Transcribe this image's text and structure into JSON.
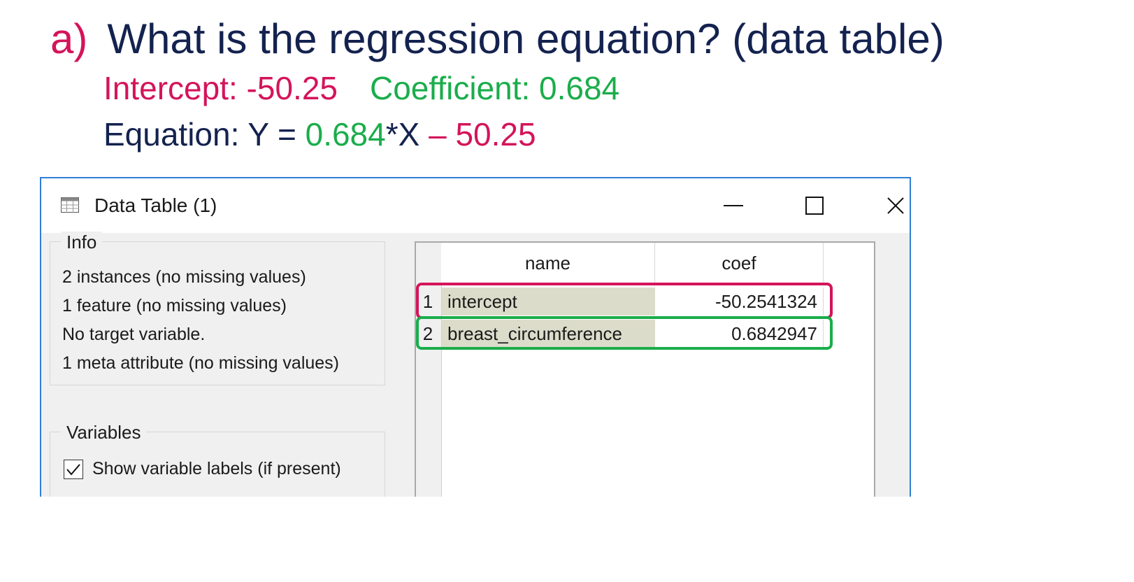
{
  "question": {
    "marker": "a)",
    "text": "What is the regression equation? (data table)"
  },
  "answer": {
    "intercept_label": "Intercept: -50.25",
    "coefficient_label": "Coefficient: 0.684",
    "equation_prefix": "Equation: Y = ",
    "equation_coef": "0.684",
    "equation_mid": "*X ",
    "equation_intercept": "– 50.25"
  },
  "window": {
    "title": "Data Table (1)",
    "icon": "table-icon",
    "controls": [
      "minimize-icon",
      "maximize-icon",
      "close-icon"
    ]
  },
  "info": {
    "label": "Info",
    "lines": [
      "2 instances (no missing values)",
      "1 feature (no missing values)",
      "No target variable.",
      "1 meta attribute (no missing values)"
    ]
  },
  "variables": {
    "label": "Variables",
    "checkbox_label": "Show variable labels (if present)",
    "checked": true
  },
  "table": {
    "headers": [
      "name",
      "coef"
    ],
    "rows": [
      {
        "index": "1",
        "name": "intercept",
        "coef": "-50.2541324"
      },
      {
        "index": "2",
        "name": "breast_circumference",
        "coef": "0.6842947"
      }
    ]
  },
  "colors": {
    "accent_red": "#d4145a",
    "accent_green": "#1aad4b",
    "navy": "#14224f",
    "window_border": "#2f7fd6"
  }
}
